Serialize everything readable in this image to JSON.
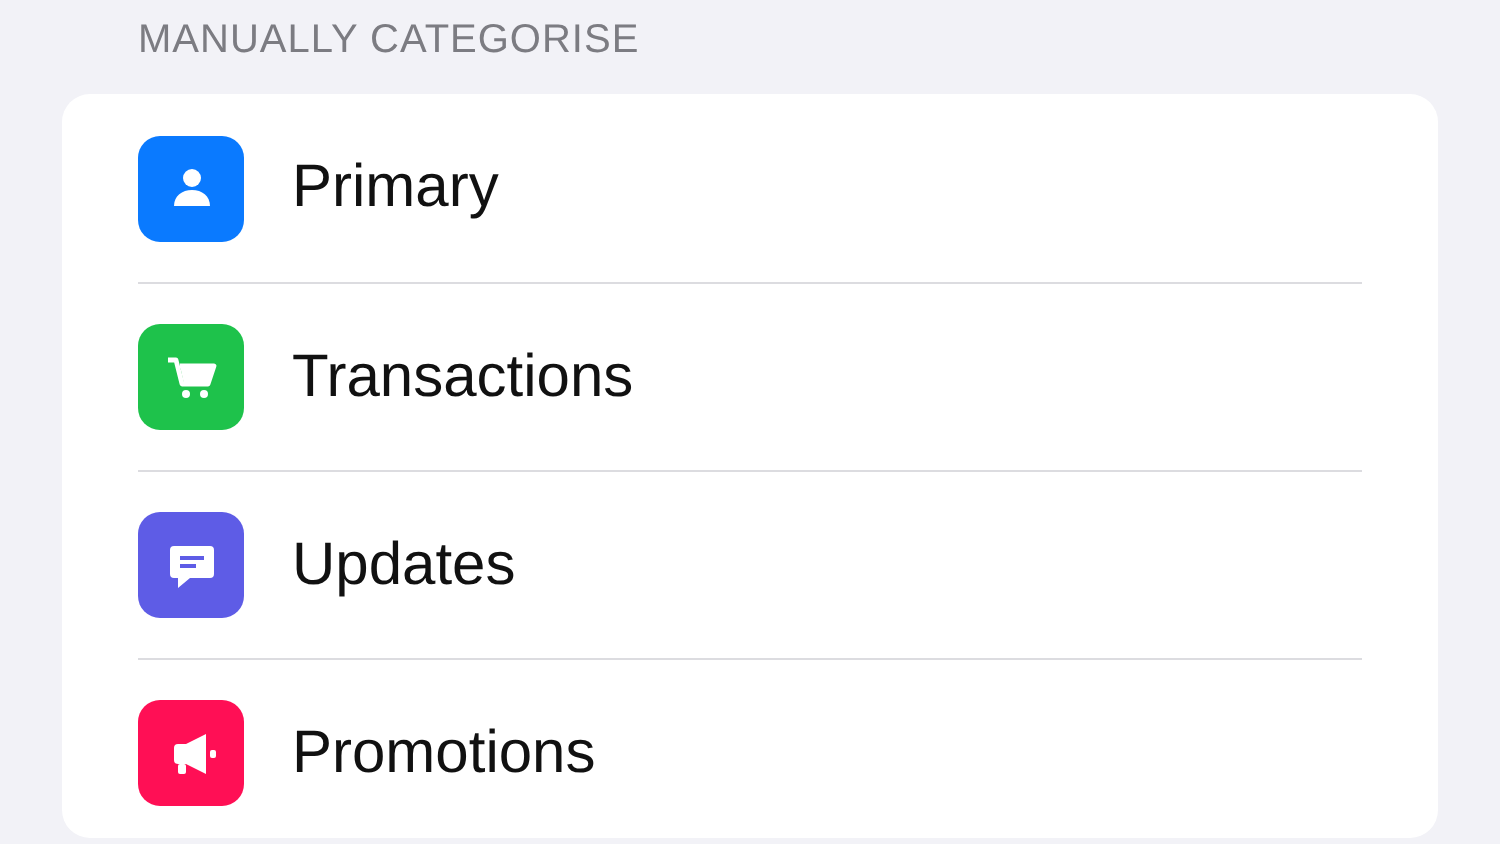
{
  "section": {
    "title": "MANUALLY CATEGORISE"
  },
  "items": [
    {
      "label": "Primary",
      "color": "#0a7aff"
    },
    {
      "label": "Transactions",
      "color": "#1ec24b"
    },
    {
      "label": "Updates",
      "color": "#5e5ce6"
    },
    {
      "label": "Promotions",
      "color": "#ff0f55"
    }
  ]
}
